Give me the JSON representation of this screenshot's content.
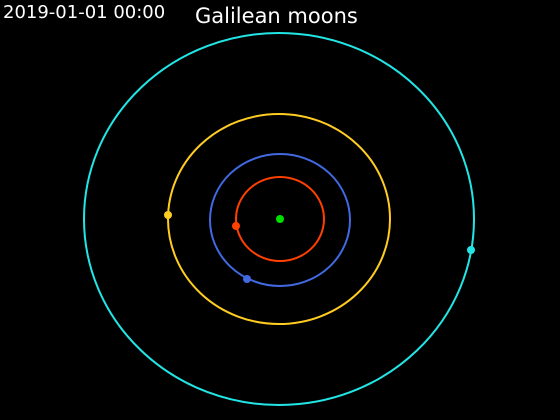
{
  "header": {
    "timestamp": "2019-01-01 00:00",
    "title": "Galilean moons"
  },
  "colors": {
    "background": "#000000",
    "text": "#ffffff",
    "jupiter": "#00e000",
    "io": "#ff4000",
    "europa": "#4169e1",
    "ganymede": "#ffcc22",
    "callisto": "#22e6e6"
  },
  "bodies": [
    {
      "key": "io",
      "color": "#ff4000"
    },
    {
      "key": "europa",
      "color": "#4169e1"
    },
    {
      "key": "ganymede",
      "color": "#ffcc22"
    },
    {
      "key": "callisto",
      "color": "#22e6e6"
    }
  ]
}
